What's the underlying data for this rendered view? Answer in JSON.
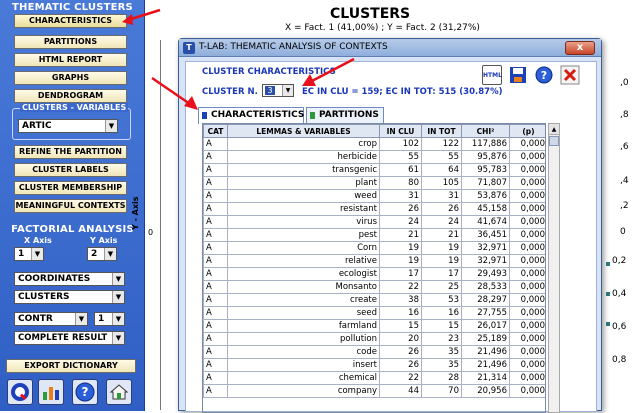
{
  "left_panel": {
    "title": "THEMATIC CLUSTERS",
    "buttons_top": [
      "CHARACTERISTICS",
      "PARTITIONS",
      "HTML REPORT",
      "GRAPHS",
      "DENDROGRAM"
    ],
    "clusters_variables_label": "CLUSTERS - VARIABLES",
    "variable_select": "ARTIC",
    "buttons_mid": [
      "REFINE THE PARTITION",
      "CLUSTER LABELS",
      "CLUSTER MEMBERSHIP",
      "MEANINGFUL CONTEXTS"
    ],
    "factorial_title": "FACTORIAL ANALYSIS",
    "x_axis_label": "X Axis",
    "y_axis_label": "Y Axis",
    "x_axis_value": "1",
    "y_axis_value": "2",
    "dd_coordinates": "COORDINATES",
    "dd_clusters": "CLUSTERS",
    "dd_contr": "CONTR",
    "dd_contr_num": "1",
    "dd_complete": "COMPLETE RESULT",
    "export_button": "EXPORT DICTIONARY",
    "icons": [
      "q-icon",
      "chart-icon",
      "help-icon",
      "home-icon"
    ]
  },
  "chart": {
    "title": "CLUSTERS",
    "subtitle": "X = Fact. 1 (41,00%) ; Y = Fact. 2 (31,27%)",
    "yaxis_label": "Y - Axis",
    "zero": "0",
    "right_ticks": [
      ",0",
      ",8",
      ",6",
      ",4",
      ",2",
      "0",
      "0,2",
      "0,4",
      "0,6",
      "0,8"
    ]
  },
  "window": {
    "title": "T-LAB: THEMATIC ANALYSIS OF CONTEXTS",
    "close": "x",
    "section_label": "CLUSTER CHARACTERISTICS",
    "cluster_n_label": "CLUSTER N.",
    "cluster_n_value": "3",
    "ec_info": "EC IN CLU = 159; EC IN TOT: 515 (30.87%)",
    "toolbar": [
      "html-icon",
      "save-icon",
      "help-icon",
      "close-icon"
    ],
    "toolbar_html_text": "HTML",
    "tabs": [
      {
        "label": "CHARACTERISTICS",
        "active": true
      },
      {
        "label": "PARTITIONS",
        "active": false
      }
    ],
    "columns": [
      "CAT",
      "LEMMAS & VARIABLES",
      "IN CLU",
      "IN TOT",
      "CHI²",
      "(p)"
    ],
    "rows": [
      [
        "A",
        "crop",
        "102",
        "122",
        "117,886",
        "0,000"
      ],
      [
        "A",
        "herbicide",
        "55",
        "55",
        "95,876",
        "0,000"
      ],
      [
        "A",
        "transgenic",
        "61",
        "64",
        "95,783",
        "0,000"
      ],
      [
        "A",
        "plant",
        "80",
        "105",
        "71,807",
        "0,000"
      ],
      [
        "A",
        "weed",
        "31",
        "31",
        "53,876",
        "0,000"
      ],
      [
        "A",
        "resistant",
        "26",
        "26",
        "45,158",
        "0,000"
      ],
      [
        "A",
        "virus",
        "24",
        "24",
        "41,674",
        "0,000"
      ],
      [
        "A",
        "pest",
        "21",
        "21",
        "36,451",
        "0,000"
      ],
      [
        "A",
        "Corn",
        "19",
        "19",
        "32,971",
        "0,000"
      ],
      [
        "A",
        "relative",
        "19",
        "19",
        "32,971",
        "0,000"
      ],
      [
        "A",
        "ecologist",
        "17",
        "17",
        "29,493",
        "0,000"
      ],
      [
        "A",
        "Monsanto",
        "22",
        "25",
        "28,533",
        "0,000"
      ],
      [
        "A",
        "create",
        "38",
        "53",
        "28,297",
        "0,000"
      ],
      [
        "A",
        "seed",
        "16",
        "16",
        "27,755",
        "0,000"
      ],
      [
        "A",
        "farmland",
        "15",
        "15",
        "26,017",
        "0,000"
      ],
      [
        "A",
        "pollution",
        "20",
        "23",
        "25,189",
        "0,000"
      ],
      [
        "A",
        "code",
        "26",
        "35",
        "21,496",
        "0,000"
      ],
      [
        "A",
        "insert",
        "26",
        "35",
        "21,496",
        "0,000"
      ],
      [
        "A",
        "chemical",
        "22",
        "28",
        "21,314",
        "0,000"
      ],
      [
        "A",
        "company",
        "44",
        "70",
        "20,956",
        "0,000"
      ]
    ]
  },
  "colors": {
    "panel_blue": "#3a68cc",
    "accent_blue_text": "#1a37b8",
    "arrow_red": "#e8101a",
    "button_cream": "#f6efcc"
  }
}
